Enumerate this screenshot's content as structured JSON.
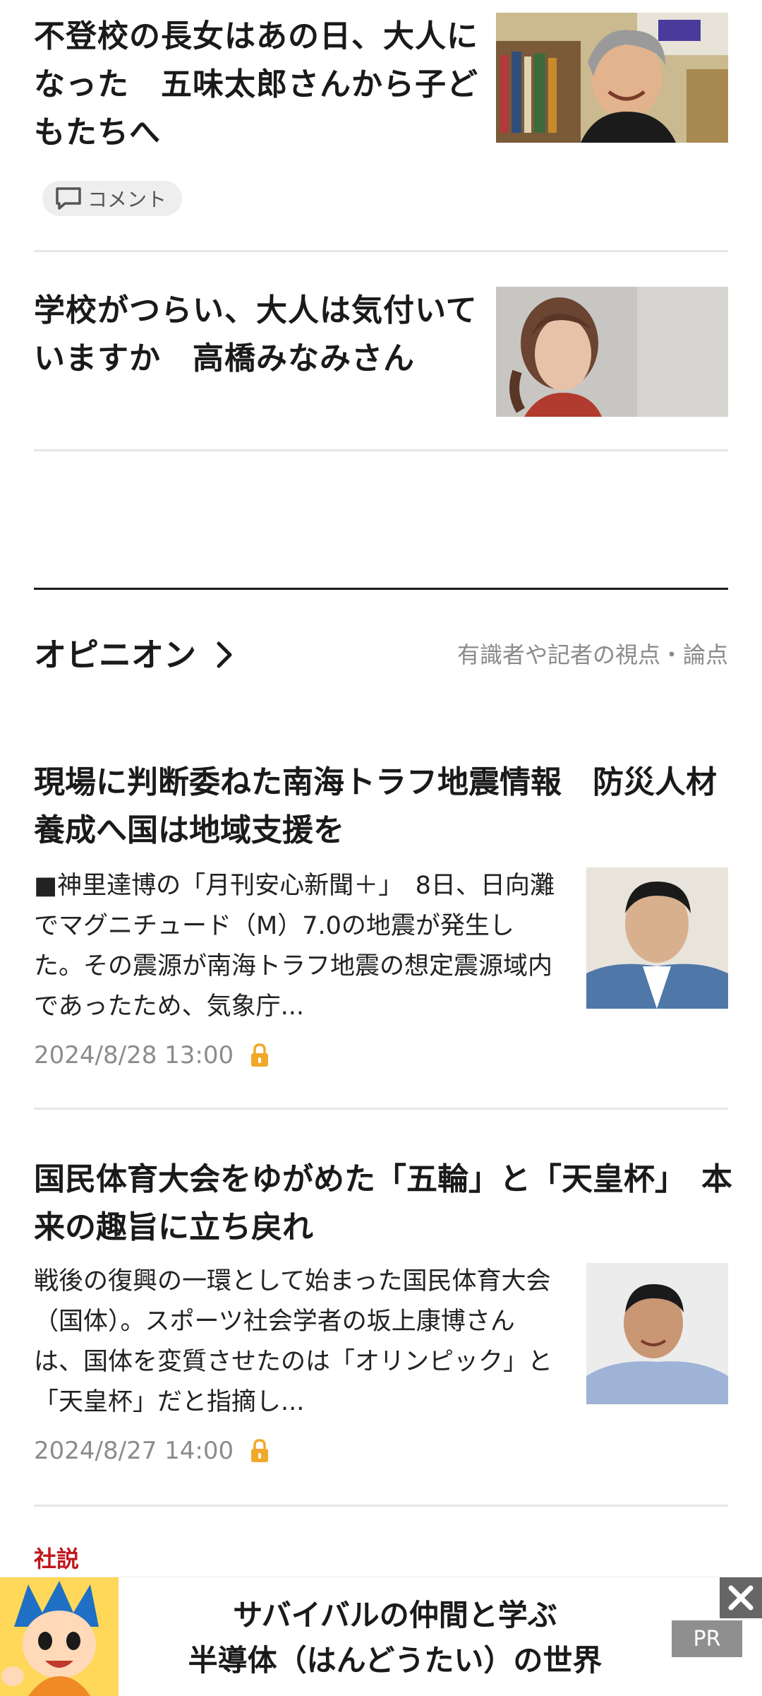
{
  "articles": [
    {
      "title": "不登校の長女はあの日、大人になった　五味太郎さんから子どもたちへ",
      "comment_label": "コメント"
    },
    {
      "title": "学校がつらい、大人は気付いていますか　高橋みなみさん"
    }
  ],
  "opinion": {
    "title": "オピニオン",
    "subtitle": "有識者や記者の視点・論点",
    "items": [
      {
        "title": "現場に判断委ねた南海トラフ地震情報　防災人材養成へ国は地域支援を",
        "body": "■神里達博の「月刊安心新聞＋」　8日、日向灘でマグニチュード（M）7.0の地震が発生した。その震源が南海トラフ地震の想定震源域内であったため、気象庁...",
        "date": "2024/8/28 13:00"
      },
      {
        "title": "国民体育大会をゆがめた「五輪」と「天皇杯」　本来の趣旨に立ち戻れ",
        "body": "戦後の復興の一環として始まった国民体育大会（国体）。スポーツ社会学者の坂上康博さんは、国体を変質させたのは「オリンピック」と「天皇杯」だと指摘し...",
        "date": "2024/8/27 14:00"
      }
    ]
  },
  "next_section_label": "社説",
  "ad": {
    "line1": "サバイバルの仲間と学ぶ",
    "line2": "半導体（はんどうたい）の世界",
    "pr_label": "PR"
  },
  "colors": {
    "accent_red": "#c0171c",
    "lock": "#f0a92a"
  }
}
